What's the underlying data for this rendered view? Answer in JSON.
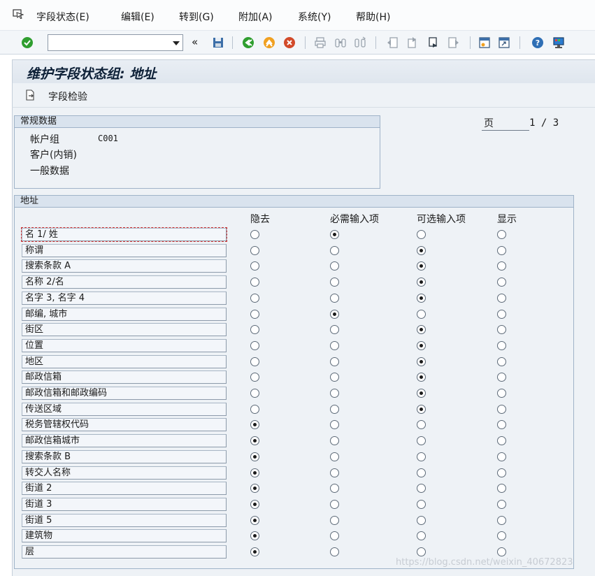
{
  "menu": [
    {
      "id": "field-status",
      "label": "字段状态(E)"
    },
    {
      "id": "edit",
      "label": "编辑(E)"
    },
    {
      "id": "goto",
      "label": "转到(G)"
    },
    {
      "id": "extras",
      "label": "附加(A)"
    },
    {
      "id": "system",
      "label": "系统(Y)"
    },
    {
      "id": "help",
      "label": "帮助(H)"
    }
  ],
  "command_field": {
    "value": ""
  },
  "toolbar_icons": [
    "check-icon",
    "chevron-double-left-icon",
    "save-icon",
    "back-icon",
    "exit-icon",
    "cancel-icon",
    "print-icon",
    "find-icon",
    "find-next-icon",
    "first-page-icon",
    "previous-page-icon",
    "next-page-icon",
    "last-page-icon",
    "create-session-icon",
    "shortcut-icon",
    "help-icon",
    "customize-layout-icon"
  ],
  "colors": {
    "accent_green": "#2f9e2f",
    "accent_orange": "#f0a020",
    "accent_red": "#d24a2a",
    "title_text": "#0c1f36"
  },
  "title": "维护字段状态组: 地址",
  "app_toolbar": {
    "field_check": "字段检验"
  },
  "general_data": {
    "header": "常规数据",
    "account_group_label": "帐户组",
    "account_group_value": "C001",
    "customer_label": "客户(内销)",
    "general_label": "一般数据"
  },
  "pager": {
    "label": "页",
    "value": "1 / 3"
  },
  "address": {
    "header": "地址",
    "columns": [
      "隐去",
      "必需输入项",
      "可选输入项",
      "显示"
    ],
    "rows": [
      {
        "label": "名 1/ 姓",
        "selected": 1
      },
      {
        "label": "称谓",
        "selected": 2
      },
      {
        "label": "搜索条款 A",
        "selected": 2
      },
      {
        "label": "名称 2/名",
        "selected": 2
      },
      {
        "label": "名字 3, 名字 4",
        "selected": 2
      },
      {
        "label": "邮编, 城市",
        "selected": 1
      },
      {
        "label": "街区",
        "selected": 2
      },
      {
        "label": "位置",
        "selected": 2
      },
      {
        "label": "地区",
        "selected": 2
      },
      {
        "label": "邮政信箱",
        "selected": 2
      },
      {
        "label": "邮政信箱和邮政编码",
        "selected": 2
      },
      {
        "label": "传送区域",
        "selected": 2
      },
      {
        "label": "税务管辖权代码",
        "selected": 0
      },
      {
        "label": "邮政信箱城市",
        "selected": 0
      },
      {
        "label": "搜索条款 B",
        "selected": 0
      },
      {
        "label": "转交人名称",
        "selected": 0
      },
      {
        "label": "街道 2",
        "selected": 0
      },
      {
        "label": "街道 3",
        "selected": 0
      },
      {
        "label": "街道 5",
        "selected": 0
      },
      {
        "label": "建筑物",
        "selected": 0
      },
      {
        "label": "层",
        "selected": 0
      }
    ]
  },
  "watermark": "https://blog.csdn.net/weixin_40672823"
}
